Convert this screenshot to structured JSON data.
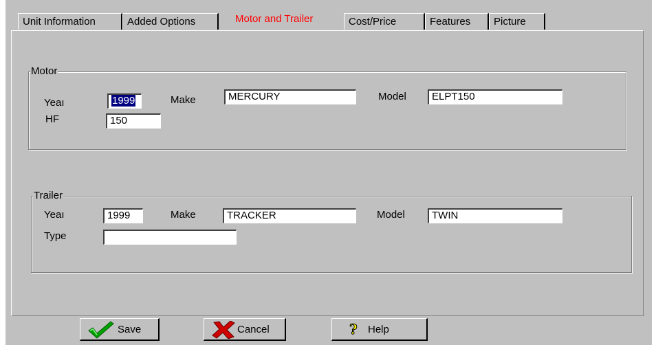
{
  "tabs": [
    {
      "label": "Unit Information"
    },
    {
      "label": "Added Options"
    },
    {
      "label": "Motor and Trailer"
    },
    {
      "label": "Cost/Price"
    },
    {
      "label": "Features"
    },
    {
      "label": "Picture"
    }
  ],
  "motor": {
    "legend": "Motor",
    "year_label": "Yeaı",
    "year_value": "1999",
    "make_label": "Make",
    "make_value": "MERCURY",
    "model_label": "Model",
    "model_value": "ELPT150",
    "hp_label": "HF",
    "hp_value": "150"
  },
  "trailer": {
    "legend": "Trailer",
    "year_label": "Yeaı",
    "year_value": "1999",
    "make_label": "Make",
    "make_value": "TRACKER",
    "model_label": "Model",
    "model_value": "TWIN",
    "type_label": "Type",
    "type_value": ""
  },
  "buttons": {
    "save": "Save",
    "cancel": "Cancel",
    "help": "Help"
  },
  "colors": {
    "active_tab": "#ff0000",
    "face": "#c0c0c0",
    "selection": "#000080"
  }
}
